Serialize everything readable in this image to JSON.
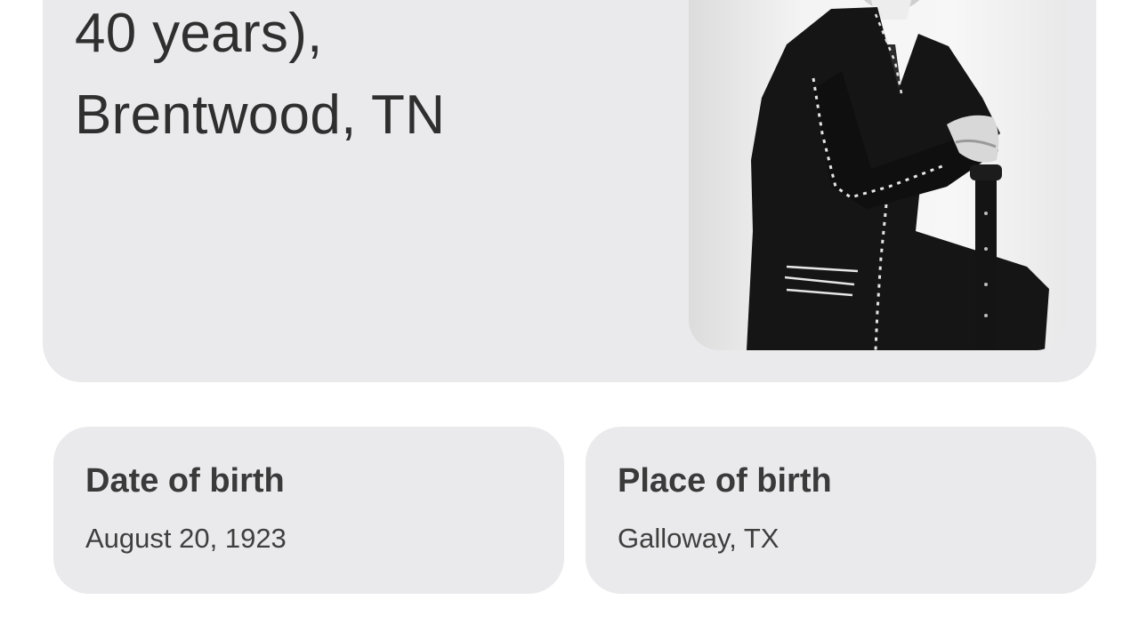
{
  "death_info": {
    "line1": "40 years),",
    "line2": "Brentwood, TN"
  },
  "portrait": {
    "icon": "person-portrait-photo"
  },
  "facts": [
    {
      "label": "Date of birth",
      "value": "August 20, 1923"
    },
    {
      "label": "Place of birth",
      "value": "Galloway, TX"
    }
  ]
}
